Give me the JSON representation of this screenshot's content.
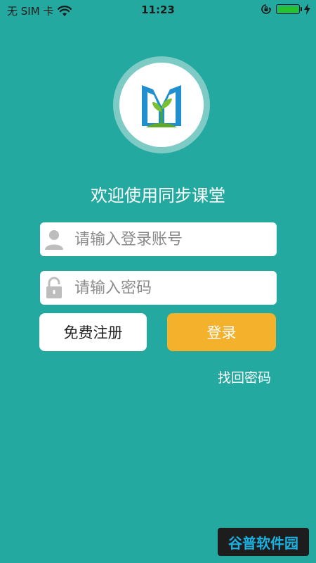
{
  "status_bar": {
    "carrier": "无 SIM 卡",
    "time": "11:23",
    "icons": [
      "wifi-icon",
      "rotation-lock-icon",
      "battery-icon",
      "charging-bolt-icon"
    ],
    "battery_color": "#25c12e"
  },
  "logo": {
    "icon": "book-sprout-logo",
    "colors": {
      "blue": "#1f8fcf",
      "green": "#7bc02e",
      "ring": "#7ecbc6"
    }
  },
  "welcome_text": "欢迎使用同步课堂",
  "form": {
    "account": {
      "placeholder": "请输入登录账号",
      "icon": "user-icon"
    },
    "password": {
      "placeholder": "请输入密码",
      "icon": "lock-icon"
    }
  },
  "buttons": {
    "register": "免费注册",
    "login": "登录"
  },
  "forgot_password": "找回密码",
  "watermark": {
    "text": "谷普软件园"
  },
  "colors": {
    "background": "#23a99f",
    "login_button": "#f4b12c"
  }
}
